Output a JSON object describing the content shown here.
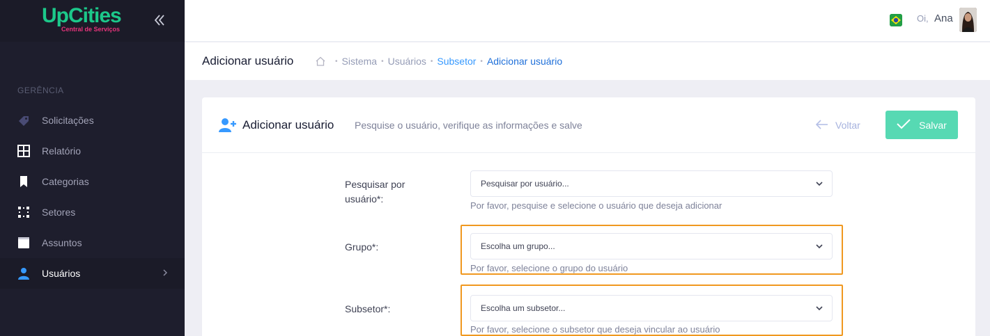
{
  "brand": {
    "name": "UpCities",
    "tagline": "Central de Serviços"
  },
  "sidebar": {
    "section_label": "GERÊNCIA",
    "items": [
      {
        "label": "Solicitações",
        "icon": "tag-icon"
      },
      {
        "label": "Relatório",
        "icon": "grid-icon"
      },
      {
        "label": "Categorias",
        "icon": "bookmark-icon"
      },
      {
        "label": "Setores",
        "icon": "dots-grid-icon"
      },
      {
        "label": "Assuntos",
        "icon": "book-icon"
      },
      {
        "label": "Usuários",
        "icon": "user-icon",
        "active": true
      }
    ]
  },
  "header": {
    "greeting": "Oi,",
    "user_name": "Ana"
  },
  "subheader": {
    "title": "Adicionar usuário",
    "breadcrumb": [
      "Sistema",
      "Usuários",
      "Subsetor",
      "Adicionar usuário"
    ]
  },
  "card": {
    "title": "Adicionar usuário",
    "subtitle": "Pesquise o usuário, verifique as informações e salve",
    "back_label": "Voltar",
    "save_label": "Salvar"
  },
  "form": {
    "fields": [
      {
        "label": "Pesquisar por usuário*:",
        "value": "Pesquisar por usuário...",
        "help": "Por favor, pesquise e selecione o usuário que deseja adicionar"
      },
      {
        "label": "Grupo*:",
        "value": "Escolha um grupo...",
        "help": "Por favor, selecione o grupo do usuário"
      },
      {
        "label": "Subsetor*:",
        "value": "Escolha um subsetor...",
        "help": "Por favor, selecione o subsetor que deseja vincular ao usuário"
      }
    ]
  },
  "colors": {
    "brand_green": "#1cc88a",
    "brand_pink": "#e8347c",
    "primary": "#3699ff",
    "success": "#57d9b3",
    "highlight": "#f0981f",
    "sidebar_bg": "#1e1e2d"
  }
}
